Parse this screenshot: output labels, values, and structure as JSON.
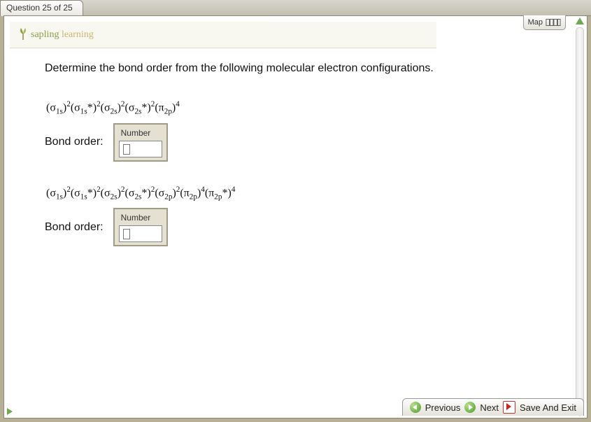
{
  "header": {
    "question_tab": "Question 25 of 25",
    "map_label": "Map"
  },
  "brand": {
    "word1": "sapling",
    "word2": "learning"
  },
  "question": {
    "prompt": "Determine the bond order from the following molecular electron configurations.",
    "items": [
      {
        "configuration_html": "(σ<sub>1s</sub>)<sup>2</sup>(σ<sub>1s</sub>*)<sup>2</sup>(σ<sub>2s</sub>)<sup>2</sup>(σ<sub>2s</sub>*)<sup>2</sup>(π<sub>2p</sub>)<sup>4</sup>",
        "label": "Bond order:",
        "input_title": "Number",
        "value": ""
      },
      {
        "configuration_html": "(σ<sub>1s</sub>)<sup>2</sup>(σ<sub>1s</sub>*)<sup>2</sup>(σ<sub>2s</sub>)<sup>2</sup>(σ<sub>2s</sub>*)<sup>2</sup>(σ<sub>2p</sub>)<sup>2</sup>(π<sub>2p</sub>)<sup>4</sup>(π<sub>2p</sub>*)<sup>4</sup>",
        "label": "Bond order:",
        "input_title": "Number",
        "value": ""
      }
    ]
  },
  "nav": {
    "previous": "Previous",
    "next": "Next",
    "save_exit": "Save And Exit"
  }
}
